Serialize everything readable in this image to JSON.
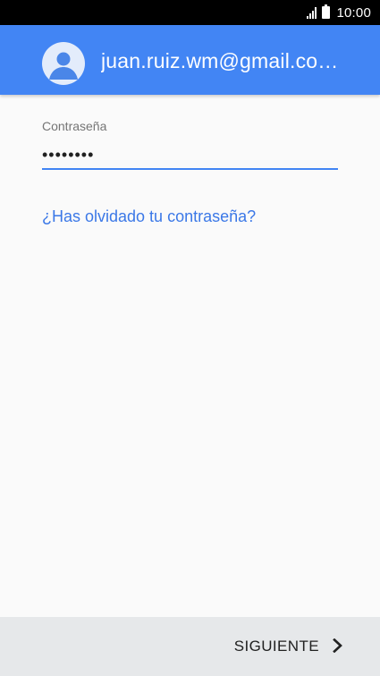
{
  "status_bar": {
    "time": "10:00",
    "icons": [
      "signal-icon",
      "battery-icon"
    ]
  },
  "account": {
    "email": "juan.ruiz.wm@gmail.co…",
    "avatar_icon": "person-icon",
    "header_color": "#4285f4"
  },
  "password": {
    "label": "Contraseña",
    "value": "••••••••"
  },
  "links": {
    "forgot_password": "¿Has olvidado tu contraseña?"
  },
  "footer": {
    "next_label": "SIGUIENTE",
    "next_icon": "chevron-right-icon"
  },
  "colors": {
    "accent": "#4285f4",
    "link": "#3b78e7",
    "footer_bg": "#e6e8ea"
  }
}
